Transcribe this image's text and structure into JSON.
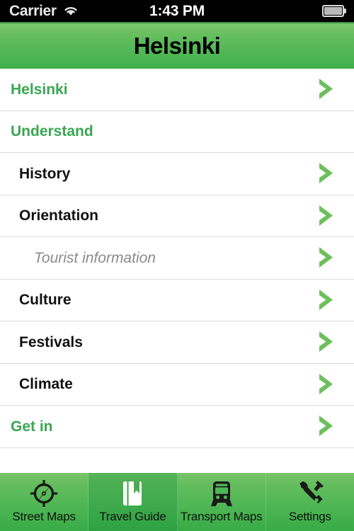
{
  "status_bar": {
    "carrier": "Carrier",
    "wifi_icon": "wifi-icon",
    "time": "1:43 PM",
    "battery_icon": "battery-icon"
  },
  "nav_bar": {
    "title": "Helsinki"
  },
  "colors": {
    "accent_green": "#3aa652",
    "bar_green_top": "#7cc66c",
    "bar_green_bottom": "#40b14c",
    "chevron_green": "#6dbf5c",
    "separator": "#dcdcdc",
    "subitem_gray": "#8b8b8b"
  },
  "list": {
    "rows": [
      {
        "label": "Helsinki",
        "level": 0,
        "chevron": true
      },
      {
        "label": "Understand",
        "level": 0,
        "chevron": false
      },
      {
        "label": "History",
        "level": 1,
        "chevron": true
      },
      {
        "label": "Orientation",
        "level": 1,
        "chevron": true
      },
      {
        "label": "Tourist information",
        "level": 2,
        "chevron": true
      },
      {
        "label": "Culture",
        "level": 1,
        "chevron": true
      },
      {
        "label": "Festivals",
        "level": 1,
        "chevron": true
      },
      {
        "label": "Climate",
        "level": 1,
        "chevron": true
      },
      {
        "label": "Get in",
        "level": 0,
        "chevron": true
      }
    ]
  },
  "tab_bar": {
    "tabs": [
      {
        "label": "Street Maps",
        "icon": "compass-icon",
        "selected": false
      },
      {
        "label": "Travel Guide",
        "icon": "book-icon",
        "selected": true
      },
      {
        "label": "Transport Maps",
        "icon": "tram-icon",
        "selected": false
      },
      {
        "label": "Settings",
        "icon": "tools-icon",
        "selected": false
      }
    ]
  }
}
